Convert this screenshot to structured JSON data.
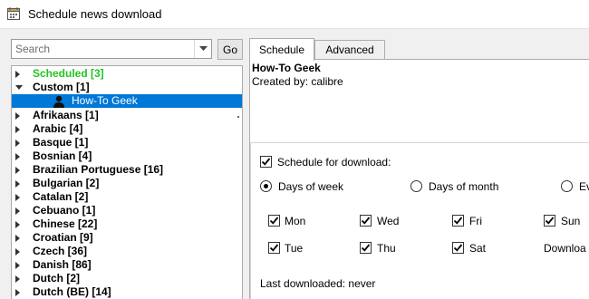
{
  "window": {
    "title": "Schedule news download"
  },
  "search": {
    "placeholder": "Search",
    "go_label": "Go"
  },
  "tree": {
    "items": [
      {
        "label": "Scheduled [3]",
        "expanded": false,
        "color": "#22c322"
      },
      {
        "label": "Custom [1]",
        "expanded": true
      },
      {
        "label": "How-To Geek",
        "selected": true
      },
      {
        "label": "Afrikaans [1]"
      },
      {
        "label": "Arabic [4]"
      },
      {
        "label": "Basque [1]"
      },
      {
        "label": "Bosnian [4]"
      },
      {
        "label": "Brazilian Portuguese [16]"
      },
      {
        "label": "Bulgarian [2]"
      },
      {
        "label": "Catalan [2]"
      },
      {
        "label": "Cebuano [1]"
      },
      {
        "label": "Chinese [22]"
      },
      {
        "label": "Croatian [9]"
      },
      {
        "label": "Czech [36]"
      },
      {
        "label": "Danish [86]"
      },
      {
        "label": "Dutch [2]"
      },
      {
        "label": "Dutch (BE) [14]"
      }
    ]
  },
  "tabs": {
    "schedule": "Schedule",
    "advanced": "Advanced"
  },
  "recipe": {
    "title": "How-To Geek",
    "created_by": "Created by: calibre"
  },
  "schedule": {
    "enable_label": "Schedule for download:",
    "enabled": true,
    "modes": {
      "days_of_week": "Days of  week",
      "days_of_month": "Days of month",
      "every_partial": "Ev"
    },
    "selected_mode": "days_of_week",
    "days": {
      "mon": {
        "label": "Mon",
        "checked": true
      },
      "wed": {
        "label": "Wed",
        "checked": true
      },
      "fri": {
        "label": "Fri",
        "checked": true
      },
      "sun": {
        "label": "Sun",
        "checked": true
      },
      "tue": {
        "label": "Tue",
        "checked": true
      },
      "thu": {
        "label": "Thu",
        "checked": true
      },
      "sat": {
        "label": "Sat",
        "checked": true
      }
    },
    "download_partial": "Downloa",
    "last_downloaded": "Last downloaded: never"
  },
  "colors": {
    "selection": "#0078d7",
    "scheduled": "#22c322"
  }
}
